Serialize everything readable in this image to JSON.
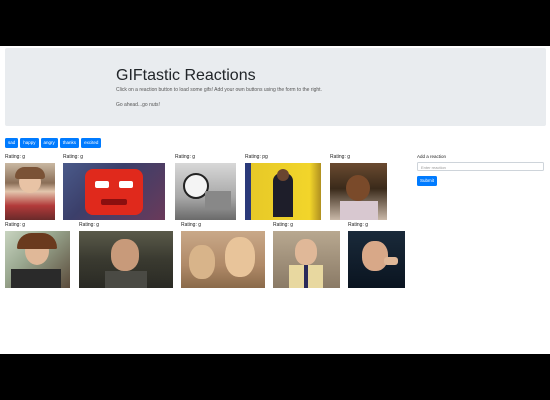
{
  "header": {
    "title": "GIFtastic Reactions",
    "lead": "Click on a reaction button to load some gifs! Add your own buttons using the form to the right.",
    "tagline": "Go ahead...go nuts!"
  },
  "buttons": [
    "sad",
    "happy",
    "angry",
    "thanks",
    "excited"
  ],
  "gifs": [
    {
      "rating": "Rating: g"
    },
    {
      "rating": "Rating: g"
    },
    {
      "rating": "Rating: g"
    },
    {
      "rating": "Rating: pg"
    },
    {
      "rating": "Rating: g"
    },
    {
      "rating": "Rating: g"
    },
    {
      "rating": "Rating: g"
    },
    {
      "rating": "Rating: g"
    },
    {
      "rating": "Rating: g"
    },
    {
      "rating": "Rating: g"
    }
  ],
  "form": {
    "label": "Add a reaction",
    "placeholder": "Enter reaction",
    "submit_label": "Submit"
  },
  "colors": {
    "primary": "#007bff",
    "jumbotron": "#e9ecef"
  }
}
